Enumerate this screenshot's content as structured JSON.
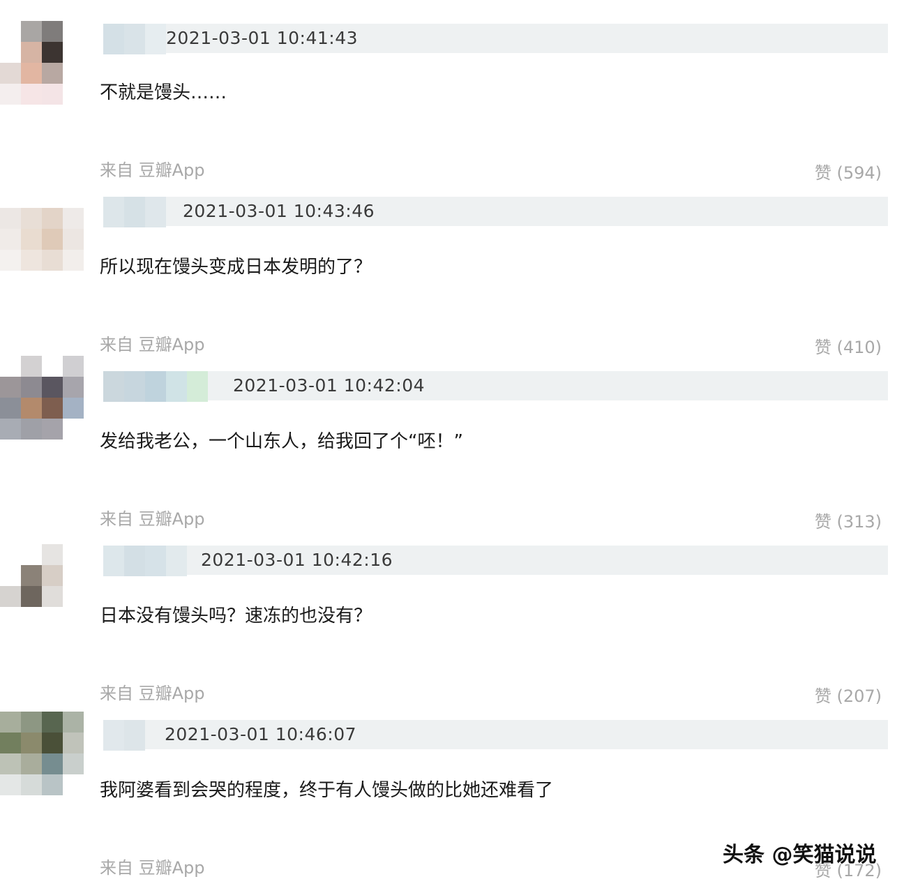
{
  "comments": [
    {
      "timestamp": "2021-03-01 10:41:43",
      "text": "不就是馒头……",
      "source": "来自 豆瓣App",
      "likes": "赞 (594)"
    },
    {
      "timestamp": "2021-03-01 10:43:46",
      "text": "所以现在馒头变成日本发明的了？",
      "source": "来自 豆瓣App",
      "likes": "赞 (410)"
    },
    {
      "timestamp": "2021-03-01 10:42:04",
      "text": "发给我老公，一个山东人，给我回了个“呸！”",
      "source": "来自 豆瓣App",
      "likes": "赞 (313)"
    },
    {
      "timestamp": "2021-03-01 10:42:16",
      "text": "日本没有馒头吗？速冻的也没有？",
      "source": "来自 豆瓣App",
      "likes": "赞 (207)"
    },
    {
      "timestamp": "2021-03-01 10:46:07",
      "text": "我阿婆看到会哭的程度，终于有人馒头做的比她还难看了",
      "source": "来自 豆瓣App",
      "likes": "赞 (172)"
    }
  ],
  "watermark": "头条 @笑猫说说",
  "colors": {
    "header_bar": "#eef1f2",
    "meta_gray": "#a8a8a8",
    "text": "#1a1a1a"
  }
}
